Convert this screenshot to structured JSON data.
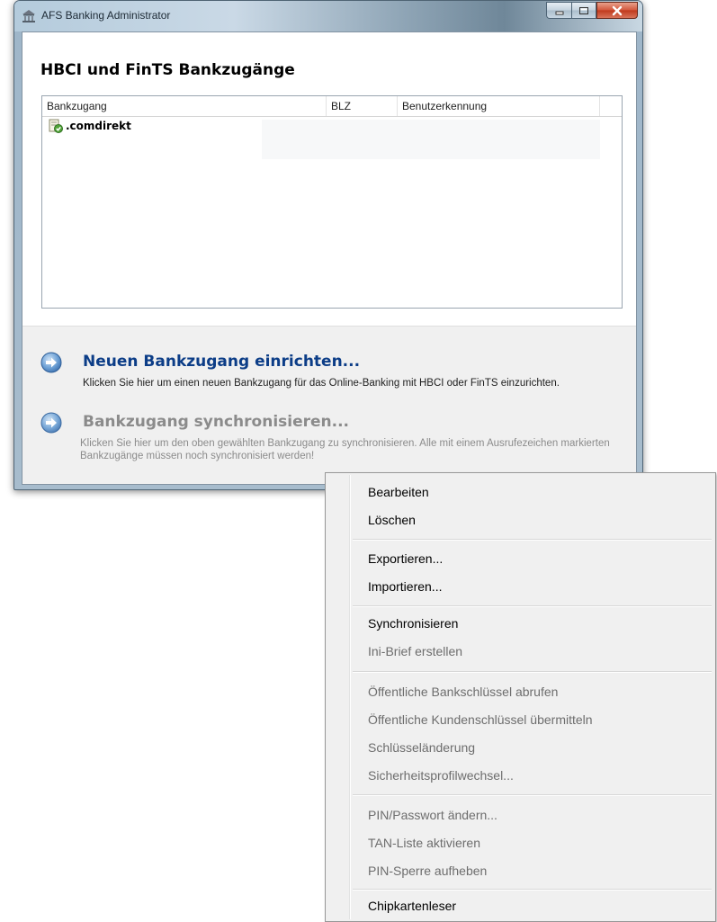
{
  "window": {
    "title": "AFS Banking Administrator",
    "heading": "HBCI und FinTS Bankzugänge"
  },
  "listview": {
    "columns": [
      "Bankzugang",
      "BLZ",
      "Benutzerkennung"
    ],
    "rows": [
      {
        "name": ".comdirekt",
        "blz": "",
        "user": ""
      }
    ]
  },
  "commands": [
    {
      "title": "Neuen Bankzugang einrichten...",
      "description": "Klicken Sie hier um einen neuen Bankzugang für das Online-Banking mit HBCI oder FinTS einzurichten.",
      "enabled": true
    },
    {
      "title": "Bankzugang synchronisieren...",
      "description": "Klicken Sie hier um den oben gewählten Bankzugang zu synchronisieren. Alle mit einem Ausrufezeichen markierten Bankzugänge müssen noch synchronisiert werden!",
      "enabled": false
    }
  ],
  "context_menu": {
    "groups": [
      [
        {
          "label": "Bearbeiten",
          "enabled": true
        },
        {
          "label": "Löschen",
          "enabled": true
        }
      ],
      [
        {
          "label": "Exportieren...",
          "enabled": true
        },
        {
          "label": "Importieren...",
          "enabled": true
        }
      ],
      [
        {
          "label": "Synchronisieren",
          "enabled": true
        },
        {
          "label": "Ini-Brief erstellen",
          "enabled": false
        }
      ],
      [
        {
          "label": "Öffentliche Bankschlüssel abrufen",
          "enabled": false
        },
        {
          "label": "Öffentliche Kundenschlüssel übermitteln",
          "enabled": false
        },
        {
          "label": "Schlüsseländerung",
          "enabled": false
        },
        {
          "label": "Sicherheitsprofilwechsel...",
          "enabled": false
        }
      ],
      [
        {
          "label": "PIN/Passwort ändern...",
          "enabled": false
        },
        {
          "label": "TAN-Liste aktivieren",
          "enabled": false
        },
        {
          "label": "PIN-Sperre aufheben",
          "enabled": false
        }
      ],
      [
        {
          "label": "Chipkartenleser",
          "enabled": true
        }
      ]
    ]
  },
  "colors": {
    "link_blue": "#0c3d87",
    "disabled_gray": "#8b8b8b",
    "arrow_blue": "#4a86c8"
  },
  "icons": [
    "bank-icon",
    "minimize-icon",
    "maximize-icon",
    "close-icon",
    "bank-account-icon",
    "arrow-right-circle-icon"
  ]
}
